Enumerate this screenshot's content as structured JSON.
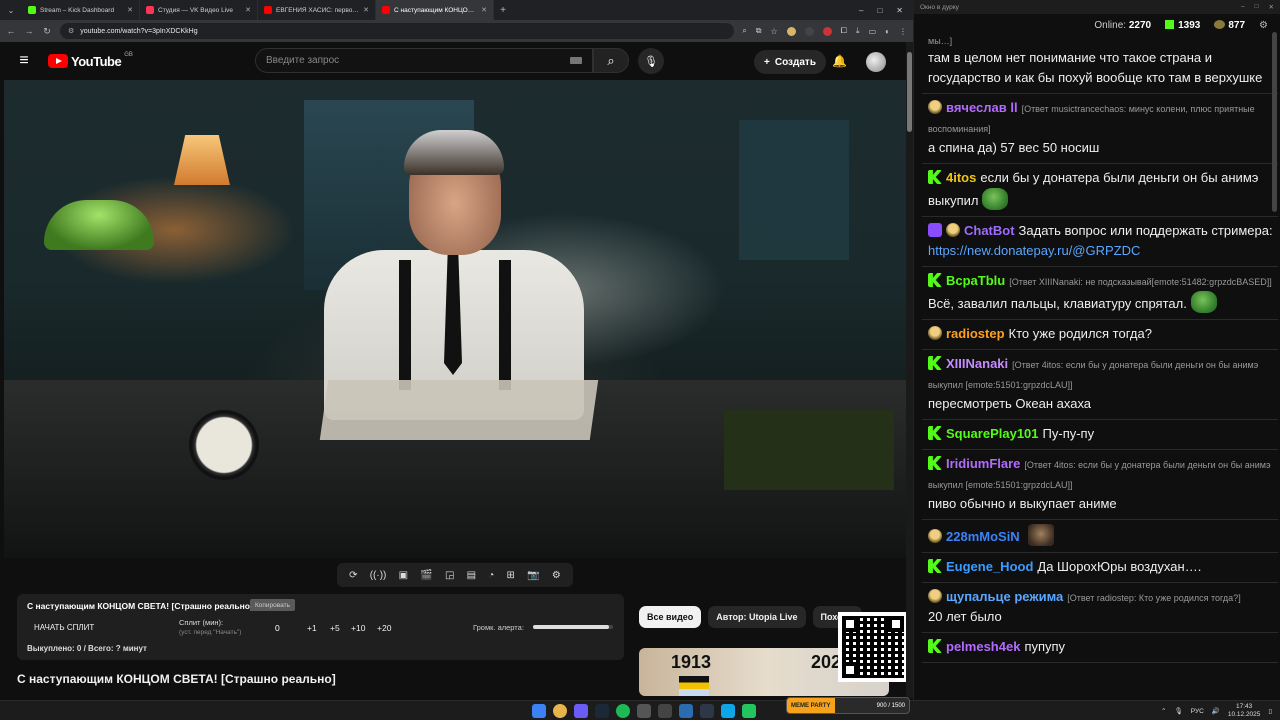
{
  "browser": {
    "tabs": [
      {
        "title": "Stream – Kick Dashboard",
        "color": "#53fc18"
      },
      {
        "title": "Студия — VK Видео Live",
        "color": "#ff3355"
      },
      {
        "title": "ЕВГЕНИЯ ХАСИС: первое инте…",
        "color": "#ff0000"
      },
      {
        "title": "С наступающим КОНЦОМ…",
        "color": "#ff0000",
        "active": true
      }
    ],
    "url": "youtube.com/watch?v=3pInXDCKkHg"
  },
  "youtube": {
    "logo": "YouTube",
    "region": "GB",
    "search_placeholder": "Введите запрос",
    "create_label": "Создать"
  },
  "split_panel": {
    "title": "С наступающим КОНЦОМ СВЕТА! [Страшно реально]",
    "copy_label": "Копировать",
    "start_label": "НАЧАТЬ СПЛИТ",
    "split_label": "Сплит (мин):",
    "split_sub": "(уст. перед \"Начать\")",
    "split_value": "0",
    "increments": [
      "+1",
      "+5",
      "+10",
      "+20"
    ],
    "volume_label": "Громк. алерта:",
    "volume_level": 0.95,
    "done_text": "Выкуплено: 0 / Всего: ? минут"
  },
  "video_title": "С наступающим КОНЦОМ СВЕТА! [Страшно реально]",
  "chips": [
    "Все видео",
    "Автор: Utopia Live",
    "Похожи"
  ],
  "thumbnail": {
    "year_left": "1913",
    "year_right": "202"
  },
  "chat": {
    "window_title": "Окно в дурку",
    "online_label": "Online:",
    "online_count": "2270",
    "kick_count": "1393",
    "pepe_count": "877",
    "messages": [
      {
        "type": "cont",
        "reply": "мы…]",
        "text": "там в целом нет понимание что такое страна и государство и как бы похуй вообще кто там в верхушке"
      },
      {
        "badges": [
          "pepe"
        ],
        "user": "вячеслав ll",
        "color": "#b36bff",
        "reply": "[Ответ musictrancechaos: минус колени, плюс приятные воспоминания]",
        "text": "а спина да) 57 вес 50 носиш"
      },
      {
        "badges": [
          "kick"
        ],
        "user": "4itos",
        "color": "#f0c419",
        "text": "если бы у донатера были деньги он бы анимэ выкупил",
        "emote": "frog"
      },
      {
        "badges": [
          "bot",
          "pepe"
        ],
        "user": "ChatBot",
        "color": "#9f6bff",
        "text": "Задать вопрос или поддержать стримера: ",
        "link": "https://new.donatepay.ru/@GRPZDC"
      },
      {
        "badges": [
          "kick"
        ],
        "user": "BcpaTblu",
        "color": "#53fc18",
        "reply": "[Ответ XIIINanaki: не подсказывай[emote:51482:grpzdcBASED]]",
        "text": "Всё, завалил пальцы, клавиатуру спрятал.",
        "emote": "frog"
      },
      {
        "badges": [
          "pepe"
        ],
        "user": "radiostep",
        "color": "#ff9f1c",
        "text": "Кто уже родился тогда?"
      },
      {
        "badges": [
          "kick"
        ],
        "user": "XIIINanaki",
        "color": "#c58cff",
        "reply": "[Ответ 4itos: если бы у донатера были деньги он бы анимэ выкупил [emote:51501:grpzdcLAU]]",
        "text": "пересмотреть Океан ахаха"
      },
      {
        "badges": [
          "kick"
        ],
        "user": "SquarePlay101",
        "color": "#53fc18",
        "text": "Пу-пу-пу"
      },
      {
        "badges": [
          "kick"
        ],
        "user": "IridiumFlare",
        "color": "#b36bff",
        "reply": "[Ответ 4itos: если бы у донатера были деньги он бы анимэ выкупил [emote:51501:grpzdcLAU]]",
        "text": "пиво обычно и выкупает аниме"
      },
      {
        "badges": [
          "pepe"
        ],
        "user": "228mMoSiN",
        "color": "#3b82f6",
        "text": "",
        "emote": "face"
      },
      {
        "badges": [
          "kick"
        ],
        "user": "Eugene_Hood",
        "color": "#3b9cff",
        "text": "Да ШорохЮры воздухан…."
      },
      {
        "badges": [
          "pepe"
        ],
        "user": "щупальце режима",
        "color": "#5aa7ff",
        "reply": "[Ответ radiostep: Кто уже родился тогда?]",
        "text": "20 лет было"
      },
      {
        "badges": [
          "kick"
        ],
        "user": "pelmesh4ek",
        "color": "#b36bff",
        "text": "пупупу"
      }
    ]
  },
  "taskbar": {
    "meme_left": "MEME PARTY",
    "meme_right": "900 / 1500",
    "lang": "РУС",
    "time": "17:43",
    "date": "10.12.2025"
  }
}
